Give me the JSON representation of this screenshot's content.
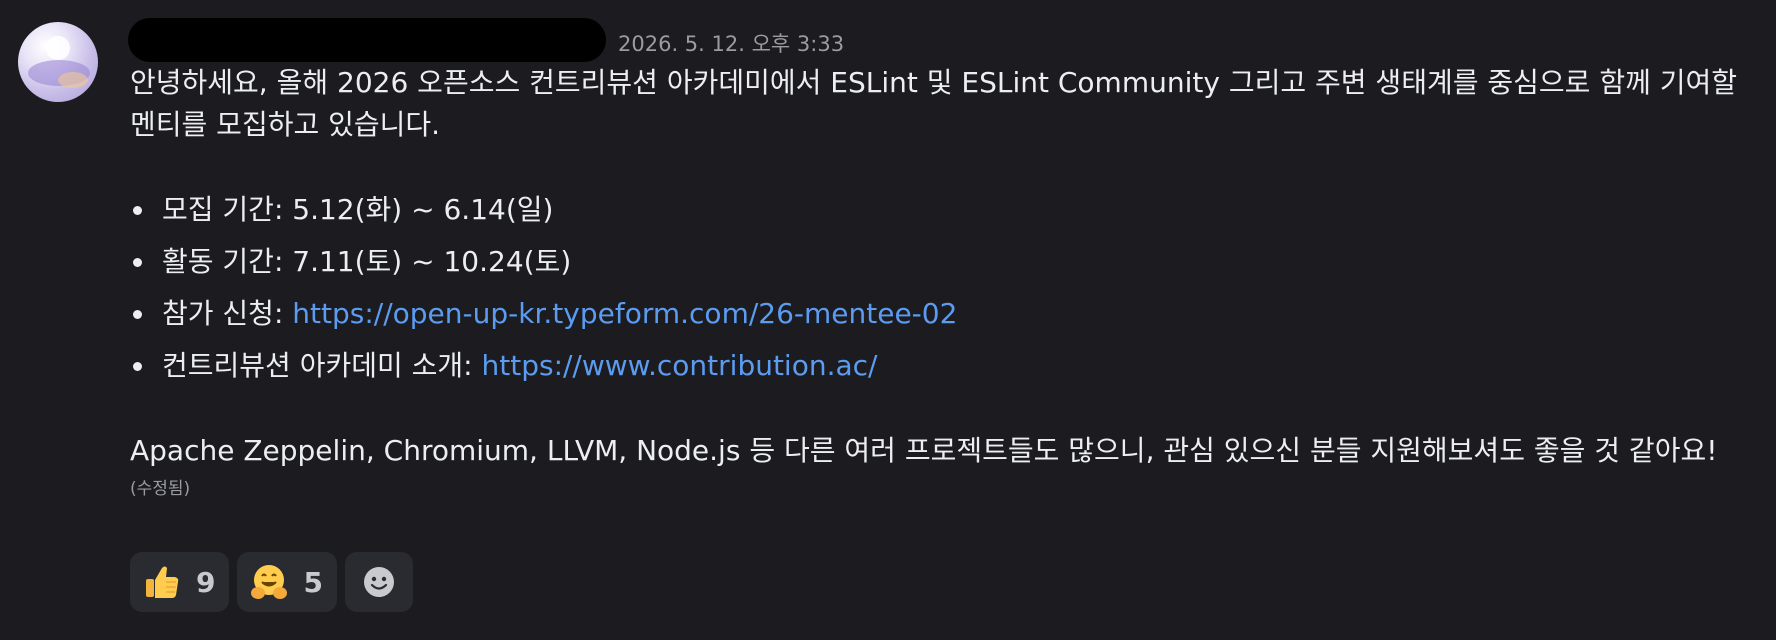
{
  "message": {
    "timestamp": "2026. 5. 12. 오후 3:33",
    "paragraph1": "안녕하세요, 올해 2026 오픈소스 컨트리뷰션 아카데미에서 ESLint 및 ESLint Community 그리고 주변 생태계를 중심으로 함께 기여할 멘티를 모집하고 있습니다.",
    "bullets": [
      {
        "label": "모집 기간: 5.12(화) ~ 6.14(일)",
        "link": ""
      },
      {
        "label": "활동 기간: 7.11(토) ~ 10.24(토)",
        "link": ""
      },
      {
        "label": "참가 신청: ",
        "link": "https://open-up-kr.typeform.com/26-mentee-02"
      },
      {
        "label": "컨트리뷰션 아카데미 소개: ",
        "link": "https://www.contribution.ac/"
      }
    ],
    "paragraph2": "Apache Zeppelin, Chromium, LLVM, Node.js 등 다른 여러 프로젝트들도 많으니, 관심 있으신 분들 지원해보셔도 좋을 것 같아요!",
    "edited_label": "(수정됨)"
  },
  "reactions": [
    {
      "emoji": "thumbs-up-icon",
      "count": "9"
    },
    {
      "emoji": "hugging-face-icon",
      "count": "5"
    }
  ],
  "colors": {
    "background": "#1b1b20",
    "text": "#eceef1",
    "link": "#5b9cf0",
    "muted": "#9b9ca3",
    "reaction_bg": "#2a2b31"
  }
}
